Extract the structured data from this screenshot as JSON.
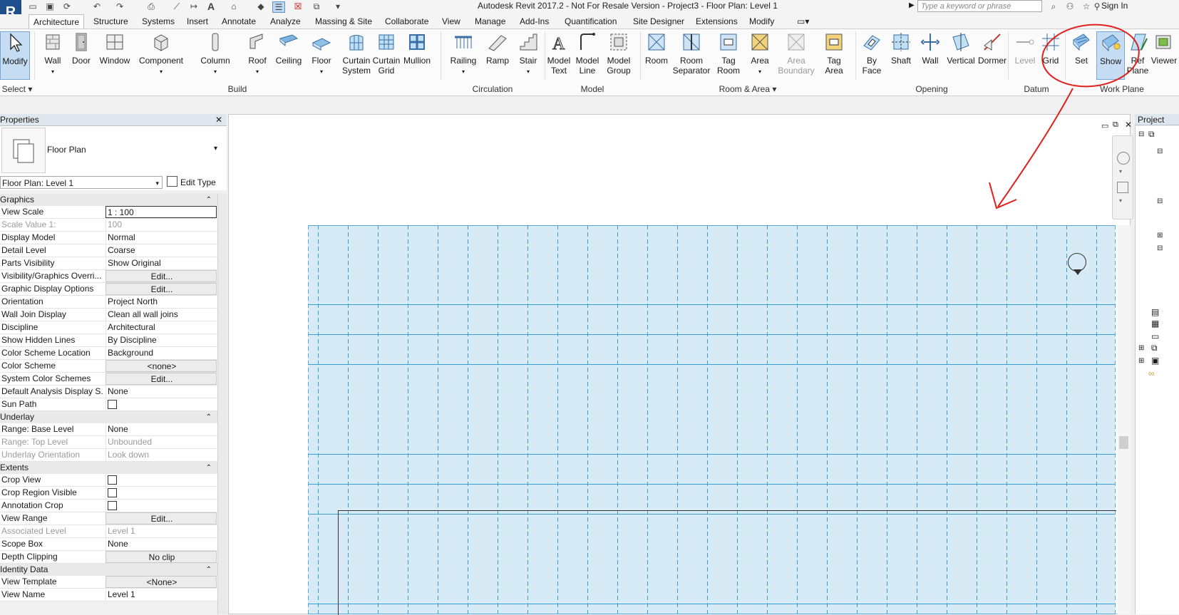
{
  "titlebar": {
    "app_letter": "R",
    "title": "Autodesk Revit 2017.2 - Not For Resale Version -     Project3 - Floor Plan: Level 1",
    "search_placeholder": "Type a keyword or phrase",
    "sign_in": "Sign In"
  },
  "tabs": [
    "Architecture",
    "Structure",
    "Systems",
    "Insert",
    "Annotate",
    "Analyze",
    "Massing & Site",
    "Collaborate",
    "View",
    "Manage",
    "Add-Ins",
    "Quantification",
    "Site Designer",
    "Extensions",
    "Modify"
  ],
  "ribbon": {
    "buttons": {
      "modify": "Modify",
      "wall": "Wall",
      "door": "Door",
      "window": "Window",
      "component": "Component",
      "column": "Column",
      "roof": "Roof",
      "ceiling": "Ceiling",
      "floor": "Floor",
      "curtain_system": "Curtain\nSystem",
      "curtain_grid": "Curtain\nGrid",
      "mullion": "Mullion",
      "railing": "Railing",
      "ramp": "Ramp",
      "stair": "Stair",
      "model_text": "Model\nText",
      "model_line": "Model\nLine",
      "model_group": "Model\nGroup",
      "room": "Room",
      "room_separator": "Room\nSeparator",
      "tag_room": "Tag\nRoom",
      "area": "Area",
      "area_boundary": "Area\nBoundary",
      "tag_area": "Tag\nArea",
      "by_face": "By\nFace",
      "shaft": "Shaft",
      "wall_opening": "Wall",
      "vertical": "Vertical",
      "dormer": "Dormer",
      "level": "Level",
      "grid": "Grid",
      "set": "Set",
      "show": "Show",
      "ref_plane": "Ref\nPlane",
      "viewer": "Viewer"
    },
    "panels": {
      "select": "Select",
      "build": "Build",
      "circulation": "Circulation",
      "model": "Model",
      "room_area": "Room & Area",
      "opening": "Opening",
      "datum": "Datum",
      "work_plane": "Work Plane"
    }
  },
  "properties": {
    "header": "Properties",
    "type_name": "Floor Plan",
    "instance_select": "Floor Plan: Level 1",
    "edit_type": "Edit Type",
    "groups": {
      "graphics": "Graphics",
      "underlay": "Underlay",
      "extents": "Extents",
      "identity": "Identity Data"
    },
    "rows": {
      "view_scale": [
        "View Scale",
        "1 : 100"
      ],
      "scale_value": [
        "Scale Value    1:",
        "100"
      ],
      "display_model": [
        "Display Model",
        "Normal"
      ],
      "detail_level": [
        "Detail Level",
        "Coarse"
      ],
      "parts_visibility": [
        "Parts Visibility",
        "Show Original"
      ],
      "vg_overrides": [
        "Visibility/Graphics Overri...",
        "Edit..."
      ],
      "graphic_display": [
        "Graphic Display Options",
        "Edit..."
      ],
      "orientation": [
        "Orientation",
        "Project North"
      ],
      "wall_join": [
        "Wall Join Display",
        "Clean all wall joins"
      ],
      "discipline": [
        "Discipline",
        "Architectural"
      ],
      "hidden_lines": [
        "Show Hidden Lines",
        "By Discipline"
      ],
      "color_scheme_loc": [
        "Color Scheme Location",
        "Background"
      ],
      "color_scheme": [
        "Color Scheme",
        "<none>"
      ],
      "system_color": [
        "System Color Schemes",
        "Edit..."
      ],
      "default_analysis": [
        "Default Analysis Display S...",
        "None"
      ],
      "sun_path": [
        "Sun Path",
        ""
      ],
      "range_base": [
        "Range: Base Level",
        "None"
      ],
      "range_top": [
        "Range: Top Level",
        "Unbounded"
      ],
      "underlay_orient": [
        "Underlay Orientation",
        "Look down"
      ],
      "crop_view": [
        "Crop View",
        ""
      ],
      "crop_region": [
        "Crop Region Visible",
        ""
      ],
      "annotation_crop": [
        "Annotation Crop",
        ""
      ],
      "view_range": [
        "View Range",
        "Edit..."
      ],
      "assoc_level": [
        "Associated Level",
        "Level 1"
      ],
      "scope_box": [
        "Scope Box",
        "None"
      ],
      "depth_clipping": [
        "Depth Clipping",
        "No clip"
      ],
      "view_template": [
        "View Template",
        "<None>"
      ],
      "view_name": [
        "View Name",
        "Level 1"
      ]
    }
  },
  "project_browser": {
    "header": "Project"
  },
  "colors": {
    "accent": "#1f4e8c",
    "grid_fill": "#d6ebf6",
    "grid_line": "#3a9ed6",
    "annotation": "#e0201b"
  }
}
